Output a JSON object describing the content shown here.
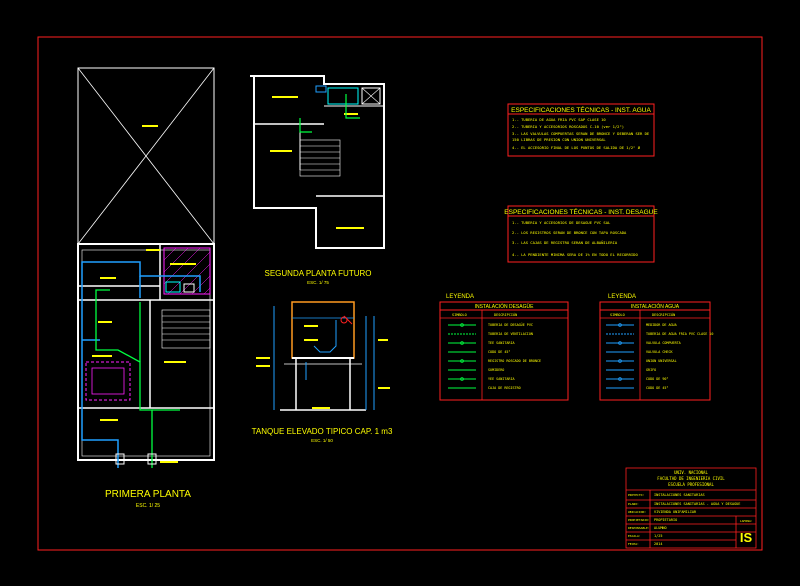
{
  "colors": {
    "background": "#000000",
    "frame": "#ff2020",
    "wall": "#ffffff",
    "text": "#ffff00",
    "water": "#20a0ff",
    "drain": "#00ff40",
    "hatch": "#ff20ff",
    "cyan": "#00ffff"
  },
  "plans": {
    "primera": {
      "title": "PRIMERA PLANTA",
      "scale": "ESC. 1/ 25"
    },
    "segunda": {
      "title": "SEGUNDA PLANTA FUTURO",
      "scale": "ESC. 1/ 75"
    },
    "tanque": {
      "title": "TANQUE ELEVADO TIPICO CAP. 1 m3",
      "scale": "ESC. 1/ 50"
    }
  },
  "spec_agua": {
    "title": "ESPECIFICACIONES TÉCNICAS - INST. AGUA",
    "lines": [
      "1.- TUBERIA DE AGUA FRIA PVC SAP CLASE 10",
      "2.- TUBERIA Y ACCESORIOS ROSCADOS C-10 (ver 1/2\")",
      "3.- LAS VALVULAS COMPUERTAS SERAN DE BRONCE Y DEBERAN SER DE",
      "    150 LIBRAS DE PRESION CON UNION UNIVERSAL",
      "4.- EL ACCESORIO FINAL DE LOS PUNTOS DE SALIDA DE 1/2\" Ø"
    ]
  },
  "spec_desague": {
    "title": "ESPECIFICACIONES TÉCNICAS - INST. DESAGUE",
    "lines": [
      "1.- TUBERIA Y ACCESORIOS DE DESAGUE PVC SAL",
      "2.- LOS REGISTROS SERAN DE BRONCE CON TAPA ROSCADA",
      "3.- LAS CAJAS DE REGISTRO SERAN DE ALBAÑILERIA",
      "4.- LA PENDIENTE MINIMA SERA DE 1% EN TODO EL RECORRIDO"
    ]
  },
  "leyenda_desague": {
    "heading": "LEYENDA",
    "title": "INSTALACIÓN DESAGÜE",
    "col_symbol": "SIMBOLO",
    "col_desc": "DESCRIPCIÓN",
    "items": [
      "TUBERIA DE DESAGÜE PVC",
      "TUBERIA DE VENTILACION",
      "TEE SANITARIA",
      "CODO DE 45°",
      "REGISTRO ROSCADO DE BRONCE",
      "SUMIDERO",
      "YEE SANITARIA",
      "CAJA DE REGISTRO"
    ]
  },
  "leyenda_agua": {
    "heading": "LEYENDA",
    "title": "INSTALACIÓN AGUA",
    "col_symbol": "SIMBOLO",
    "col_desc": "DESCRIPCIÓN",
    "items": [
      "MEDIDOR DE AGUA",
      "TUBERIA DE AGUA FRIA PVC CLASE 10",
      "VALVULA COMPUERTA",
      "VALVULA CHECK",
      "UNION UNIVERSAL",
      "GRIFO",
      "CODO DE 90°",
      "CODO DE 45°"
    ]
  },
  "title_block": {
    "header1": "UNIV. NACIONAL",
    "header2": "FACULTAD DE INGENIERIA CIVIL",
    "header3": "ESCUELA PROFESIONAL",
    "row_proyecto_label": "PROYECTO:",
    "row_proyecto": "INSTALACIONES SANITARIAS",
    "row_plano_label": "PLANO:",
    "row_plano": "INSTALACIONES SANITARIAS - AGUA Y DESAGUE",
    "row_ubic_label": "UBICACION:",
    "row_ubic": "VIVIENDA UNIFAMILIAR",
    "row_prop_label": "PROPIETARIO:",
    "row_prop": "PROPIETARIO",
    "row_resp_label": "RESPONSABLE:",
    "row_resp": "ALUMNO",
    "row_escala_label": "ESCALA:",
    "row_escala": "1/25",
    "row_fecha_label": "FECHA:",
    "row_fecha": "2014",
    "lamina_label": "LAMINA:",
    "lamina_code": "IS"
  }
}
